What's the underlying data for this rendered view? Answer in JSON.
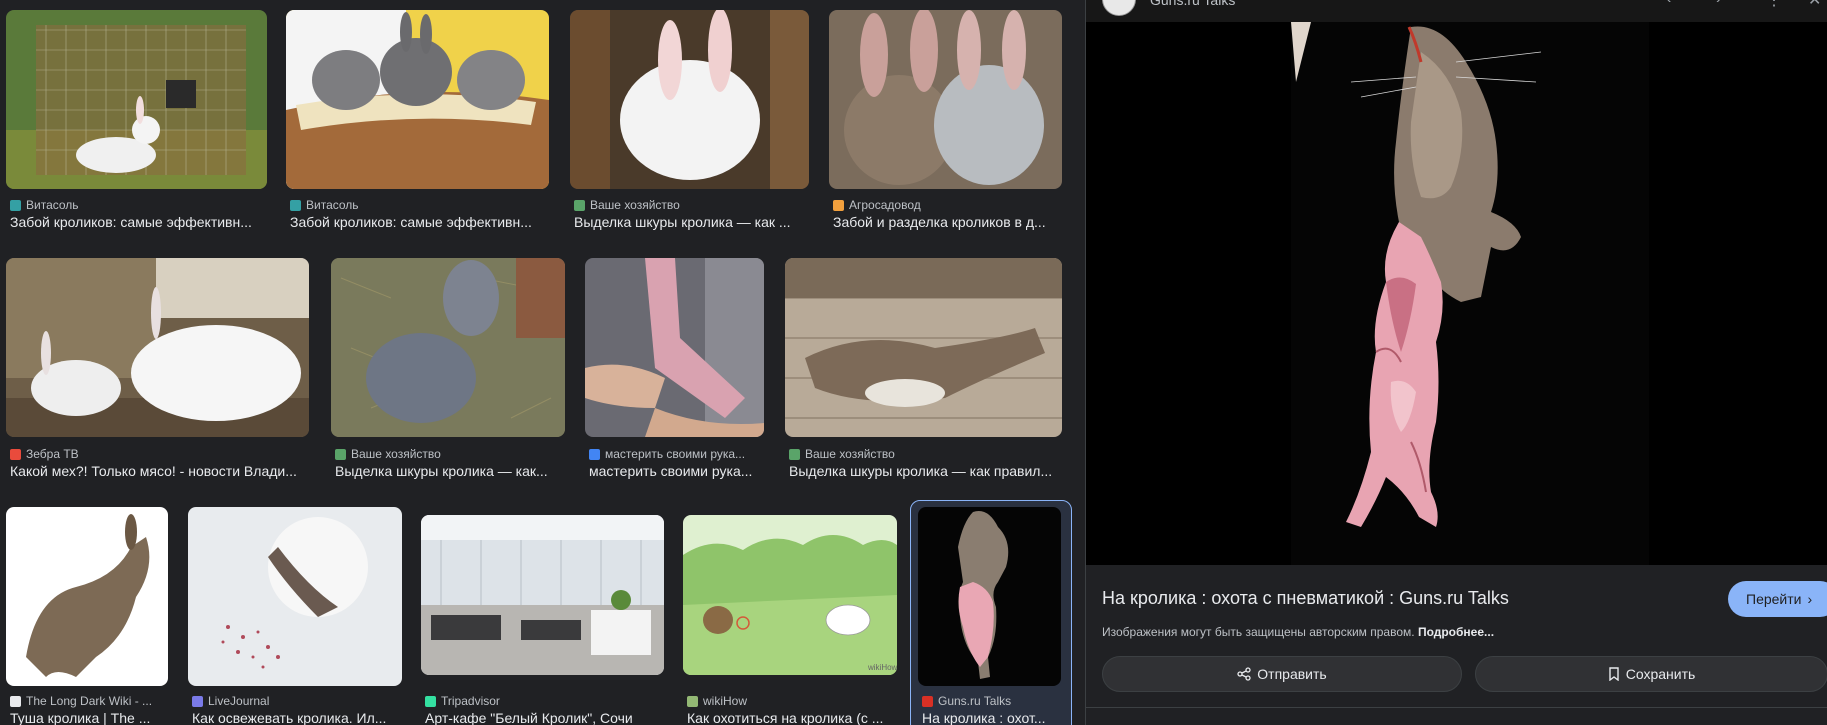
{
  "results": [
    {
      "source": "Витасоль",
      "title": "Забой кроликов: самые эффективн...",
      "fav": "#34a0a4"
    },
    {
      "source": "Витасоль",
      "title": "Забой кроликов: самые эффективн...",
      "fav": "#34a0a4"
    },
    {
      "source": "Ваше хозяйство",
      "title": "Выделка шкуры кролика — как ...",
      "fav": "#5aa469"
    },
    {
      "source": "Агросадовод",
      "title": "Забой и разделка кроликов в д...",
      "fav": "#f2a03d"
    },
    {
      "source": "Зебра ТВ",
      "title": "Какой мех?! Только мясо! - новости Влади...",
      "fav": "#e94b3c"
    },
    {
      "source": "Ваше хозяйство",
      "title": "Выделка шкуры кролика — как...",
      "fav": "#5aa469"
    },
    {
      "source": "мастерить своими рука...",
      "title": "мастерить своими рука...",
      "fav": "#4285f4"
    },
    {
      "source": "Ваше хозяйство",
      "title": "Выделка шкуры кролика — как правил...",
      "fav": "#5aa469"
    },
    {
      "source": "The Long Dark Wiki - ...",
      "title": "Туша кролика | The ...",
      "fav": "#e8eaed"
    },
    {
      "source": "LiveJournal",
      "title": "Как освежевать кролика. Ил...",
      "fav": "#7a7ae8"
    },
    {
      "source": "Tripadvisor",
      "title": "Арт-кафе \"Белый Кролик\", Сочи",
      "fav": "#34e0a1"
    },
    {
      "source": "wikiHow",
      "title": "Как охотиться на кролика (с ...",
      "fav": "#93b874"
    },
    {
      "source": "Guns.ru Talks",
      "title": "На кролика : охот...",
      "fav": "#d93025"
    }
  ],
  "preview": {
    "site_name": "Guns.ru Talks",
    "title": "На кролика : охота с пневматикой : Guns.ru Talks",
    "visit_label": "Перейти",
    "copyright_text": "Изображения могут быть защищены авторским правом.",
    "copyright_link": "Подробнее...",
    "share_label": "Отправить",
    "save_label": "Сохранить"
  },
  "icons": {
    "share": "share-icon",
    "save": "bookmark-icon",
    "visit": "chevron-right-icon",
    "back": "chevron-left-icon",
    "forward": "chevron-right-icon",
    "more": "more-vert-icon",
    "close": "close-icon"
  },
  "colors": {
    "background": "#202124",
    "accent": "#8ab4f8",
    "text": "#e8eaed",
    "muted": "#bdc1c6"
  }
}
